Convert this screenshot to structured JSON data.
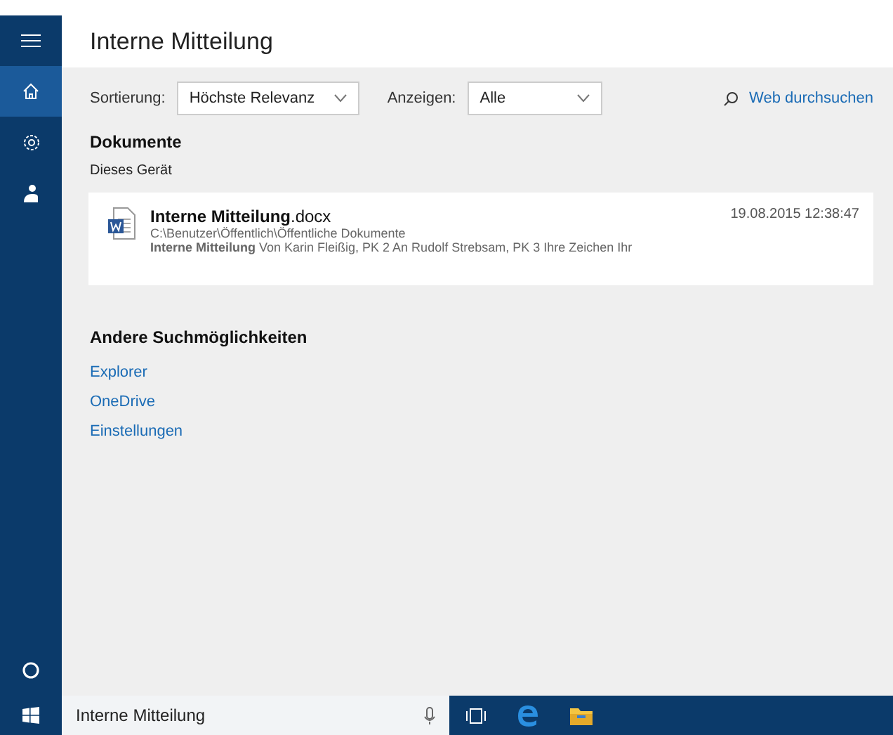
{
  "sidebar": {
    "items": [
      {
        "kind": "home",
        "selected": true
      },
      {
        "kind": "settings",
        "selected": false
      },
      {
        "kind": "person",
        "selected": false
      }
    ]
  },
  "header": {
    "title": "Interne Mitteilung"
  },
  "filters": {
    "sort_label": "Sortierung:",
    "sort_value": "Höchste Relevanz",
    "show_label": "Anzeigen:",
    "show_value": "Alle",
    "web_search": "Web durchsuchen"
  },
  "documents": {
    "heading": "Dokumente",
    "subheading": "Dieses Gerät",
    "results": [
      {
        "title": "**Interne Mitteilung**.docx",
        "path": "C:\\Benutzer\\Öffentlich\\Öffentliche Dokumente",
        "snippet": "**Interne Mitteilung** Von Karin Fleißig, PK 2 An Rudolf Strebsam, PK 3 Ihre Zeichen Ihr",
        "date": "19.08.2015 12:38:47"
      }
    ]
  },
  "other": {
    "heading": "Andere Suchmöglichkeiten",
    "links": [
      "Explorer",
      "OneDrive",
      "Einstellungen"
    ]
  },
  "taskbar": {
    "search_value": "Interne Mitteilung"
  }
}
